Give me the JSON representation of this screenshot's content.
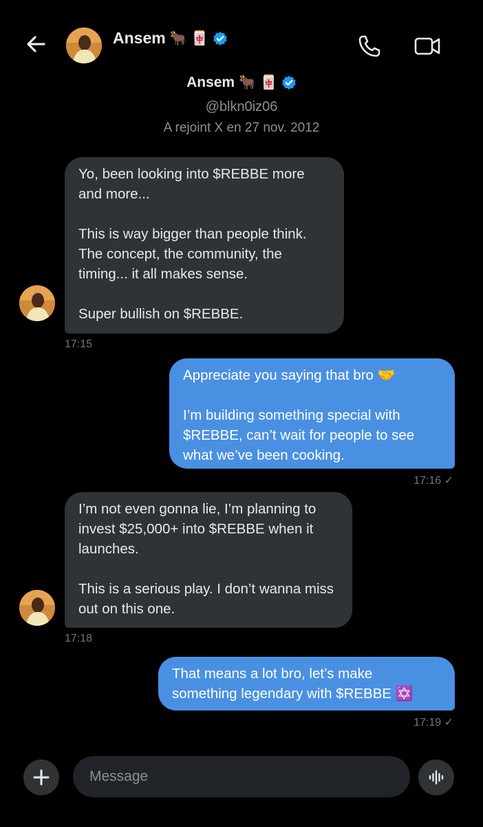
{
  "header": {
    "name": "Ansem",
    "emoji1": "🐂",
    "emoji2": "🀄",
    "back_icon": "arrow-left-icon",
    "call_icon": "phone-icon",
    "video_icon": "video-camera-icon"
  },
  "profile": {
    "name": "Ansem",
    "emoji1": "🐂",
    "emoji2": "🀄",
    "handle": "@blkn0iz06",
    "joined": "A rejoint X en 27 nov. 2012"
  },
  "messages": [
    {
      "direction": "incoming",
      "paragraphs": [
        "Yo, been looking into $REBBE more and more...",
        "This is way bigger than people think. The concept, the community, the timing... it all makes sense.",
        "Super bullish on $REBBE."
      ],
      "time": "17:15"
    },
    {
      "direction": "outgoing",
      "paragraphs": [
        "Appreciate you saying that bro 🤝",
        "I’m building something special with $REBBE, can’t wait for people to see what we’ve been cooking."
      ],
      "time": "17:16 ✓"
    },
    {
      "direction": "incoming",
      "paragraphs": [
        "I’m not even gonna lie, I’m planning to invest $25,000+ into $REBBE when it launches.",
        "This is a serious play. I don’t wanna miss out on this one."
      ],
      "time": "17:18"
    },
    {
      "direction": "outgoing",
      "paragraphs": [
        "That means a lot bro, let’s make something legendary with $REBBE ✡️"
      ],
      "time": "17:19 ✓"
    }
  ],
  "composer": {
    "placeholder": "Message",
    "add_icon": "plus-icon",
    "voice_icon": "voice-wave-icon"
  },
  "colors": {
    "background": "#000000",
    "incoming_bubble": "#2f3336",
    "outgoing_bubble": "#4a90e2",
    "verified": "#1d9bf0"
  }
}
